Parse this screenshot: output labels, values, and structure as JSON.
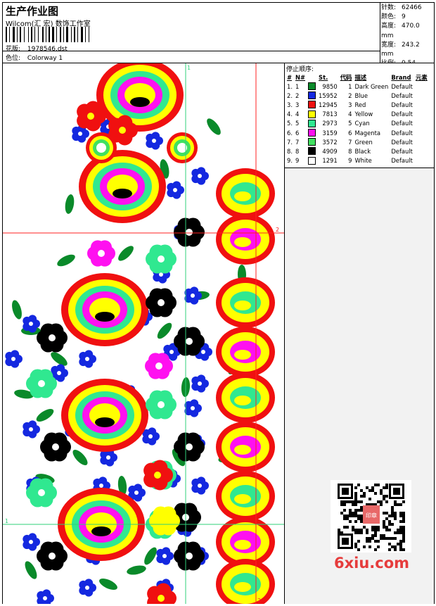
{
  "header": {
    "title": "生产作业图",
    "subtitle": "Wilcom(汇 宏) 数饰工作室",
    "file_label": "花版:",
    "file_value": "1978546.dst",
    "colorway_label": "色位:",
    "colorway_value": "Colorway 1"
  },
  "stats": [
    {
      "label": "针数:",
      "value": "62466"
    },
    {
      "label": "颜色:",
      "value": "9"
    },
    {
      "label": "高度:",
      "value": "470.0 mm"
    },
    {
      "label": "宽度:",
      "value": "243.2 mm"
    },
    {
      "label": "比例:",
      "value": "0.54"
    }
  ],
  "stop_sequence": {
    "title": "停止顺序:",
    "headers": [
      "#",
      "N#",
      "St.",
      "代码",
      "描述",
      "Brand",
      "元素"
    ],
    "rows": [
      {
        "num": "1.",
        "n": "1",
        "color": "#0a8a2a",
        "st": "9850",
        "code": "1",
        "desc": "Dark Green",
        "brand": "Default"
      },
      {
        "num": "2.",
        "n": "2",
        "color": "#1428e0",
        "st": "15952",
        "code": "2",
        "desc": "Blue",
        "brand": "Default"
      },
      {
        "num": "3.",
        "n": "3",
        "color": "#f01010",
        "st": "12945",
        "code": "3",
        "desc": "Red",
        "brand": "Default"
      },
      {
        "num": "4.",
        "n": "4",
        "color": "#ffff00",
        "st": "7813",
        "code": "4",
        "desc": "Yellow",
        "brand": "Default"
      },
      {
        "num": "5.",
        "n": "5",
        "color": "#30e890",
        "st": "2973",
        "code": "5",
        "desc": "Cyan",
        "brand": "Default"
      },
      {
        "num": "6.",
        "n": "6",
        "color": "#ff10f0",
        "st": "3159",
        "code": "6",
        "desc": "Magenta",
        "brand": "Default"
      },
      {
        "num": "7.",
        "n": "7",
        "color": "#40e060",
        "st": "3572",
        "code": "7",
        "desc": "Green",
        "brand": "Default"
      },
      {
        "num": "8.",
        "n": "8",
        "color": "#000000",
        "st": "4909",
        "code": "8",
        "desc": "Black",
        "brand": "Default"
      },
      {
        "num": "9.",
        "n": "9",
        "color": "#ffffff",
        "st": "1291",
        "code": "9",
        "desc": "White",
        "brand": "Default"
      }
    ]
  },
  "guides": {
    "markers": [
      "1",
      "2",
      "1",
      "2"
    ]
  },
  "watermark": "6xiu.com",
  "qr_stamp": "印章",
  "colors": {
    "guide_green": "#2fd07a",
    "guide_red": "#ff2020",
    "panel_grey": "#f2f2f2"
  }
}
